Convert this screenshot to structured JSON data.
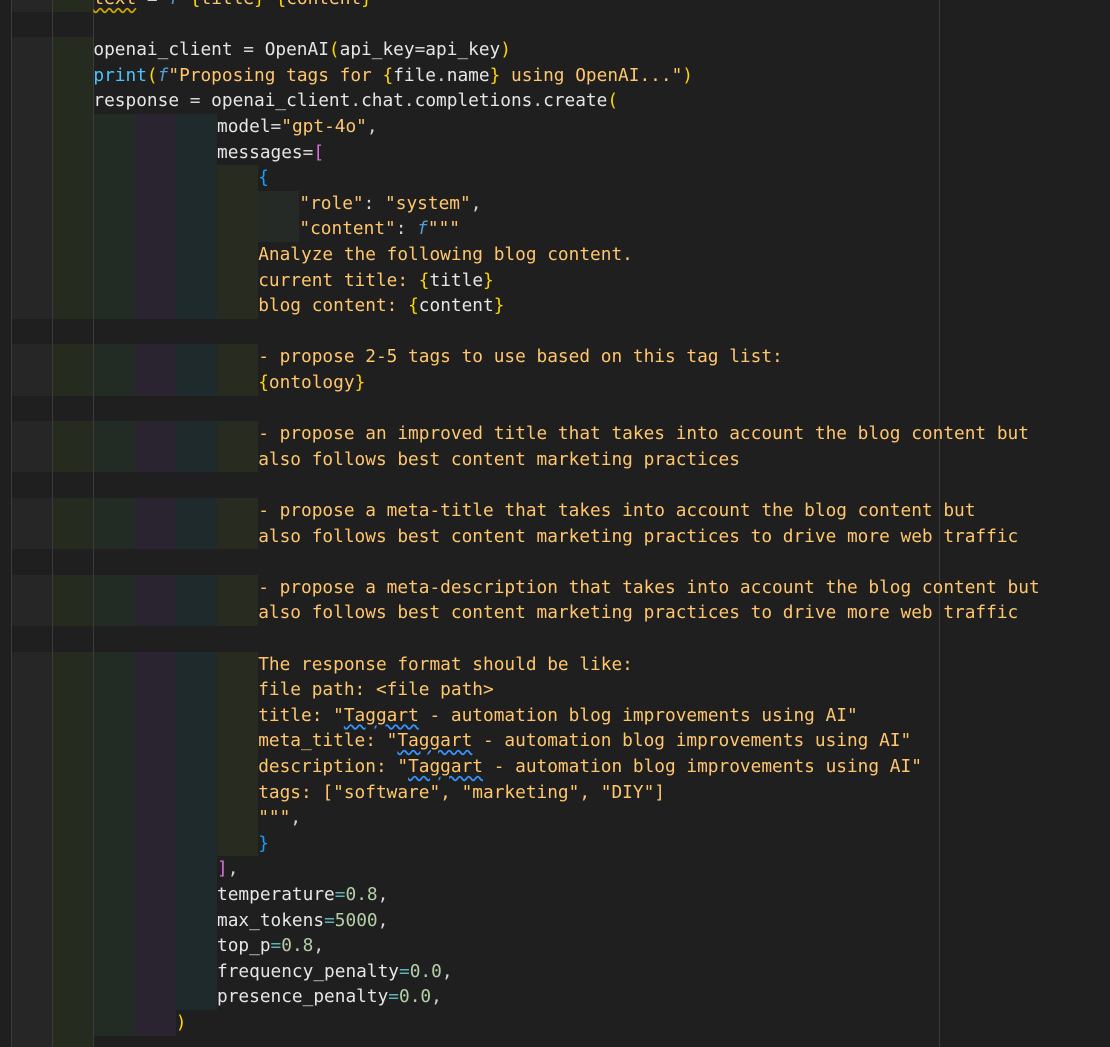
{
  "editor": {
    "colors": {
      "background": "#1f1f1f",
      "default": "#e6e6e6",
      "punct": "#d4d4d4",
      "string": "#ffc66d",
      "keyword_fn": "#4fc1ff",
      "fstring_prefix": "#569cd6",
      "brace_gold": "#ffd700",
      "bracket_pink": "#da70d6",
      "brace_blue": "#179fff",
      "number": "#b5cea8",
      "operator": "#5fb3b3",
      "variable": "#cfe2f3"
    },
    "lines": [
      {
        "indent": 9,
        "segments": [
          {
            "t": "text",
            "c": "#ffc66d",
            "sq": "gold"
          },
          {
            "t": " = ",
            "c": "#d4d4d4"
          },
          {
            "t": "f",
            "c": "#569cd6",
            "i": true
          },
          {
            "t": "\"",
            "c": "#ffc66d"
          },
          {
            "t": "{",
            "c": "#ffd700"
          },
          {
            "t": "title",
            "c": "#ffc66d"
          },
          {
            "t": "}",
            "c": "#ffd700"
          },
          {
            "t": " ",
            "c": "#ffc66d"
          },
          {
            "t": "{",
            "c": "#ffd700"
          },
          {
            "t": "content",
            "c": "#ffc66d"
          },
          {
            "t": "}",
            "c": "#ffd700"
          }
        ]
      },
      {
        "indent": 0,
        "segments": []
      },
      {
        "indent": 9,
        "segments": [
          {
            "t": "openai_client",
            "c": "#e6e6e6"
          },
          {
            "t": " = ",
            "c": "#d4d4d4"
          },
          {
            "t": "OpenAI",
            "c": "#e6e6e6"
          },
          {
            "t": "(",
            "c": "#ffd700"
          },
          {
            "t": "api_key",
            "c": "#e6e6e6"
          },
          {
            "t": "=",
            "c": "#d4d4d4"
          },
          {
            "t": "api_key",
            "c": "#e6e6e6"
          },
          {
            "t": ")",
            "c": "#ffd700"
          }
        ]
      },
      {
        "indent": 9,
        "segments": [
          {
            "t": "print",
            "c": "#4fc1ff"
          },
          {
            "t": "(",
            "c": "#ffd700"
          },
          {
            "t": "f",
            "c": "#569cd6",
            "i": true
          },
          {
            "t": "\"Proposing tags for ",
            "c": "#ffc66d"
          },
          {
            "t": "{",
            "c": "#ffd700"
          },
          {
            "t": "file",
            "c": "#e6e6e6"
          },
          {
            "t": ".",
            "c": "#d4d4d4"
          },
          {
            "t": "name",
            "c": "#e6e6e6"
          },
          {
            "t": "}",
            "c": "#ffd700"
          },
          {
            "t": " using OpenAI...\"",
            "c": "#ffc66d"
          },
          {
            "t": ")",
            "c": "#ffd700"
          }
        ]
      },
      {
        "indent": 9,
        "segments": [
          {
            "t": "response",
            "c": "#e6e6e6"
          },
          {
            "t": " = ",
            "c": "#d4d4d4"
          },
          {
            "t": "openai_client",
            "c": "#e6e6e6"
          },
          {
            "t": ".",
            "c": "#d4d4d4"
          },
          {
            "t": "chat",
            "c": "#e6e6e6"
          },
          {
            "t": ".",
            "c": "#d4d4d4"
          },
          {
            "t": "completions",
            "c": "#e6e6e6"
          },
          {
            "t": ".",
            "c": "#d4d4d4"
          },
          {
            "t": "create",
            "c": "#e6e6e6"
          },
          {
            "t": "(",
            "c": "#ffd700"
          }
        ]
      },
      {
        "indent": 21,
        "segments": [
          {
            "t": "model",
            "c": "#e6e6e6"
          },
          {
            "t": "=",
            "c": "#d4d4d4"
          },
          {
            "t": "\"gpt-4o\"",
            "c": "#ffc66d"
          },
          {
            "t": ",",
            "c": "#d4d4d4"
          }
        ]
      },
      {
        "indent": 21,
        "segments": [
          {
            "t": "messages",
            "c": "#e6e6e6"
          },
          {
            "t": "=",
            "c": "#d4d4d4"
          },
          {
            "t": "[",
            "c": "#da70d6"
          }
        ]
      },
      {
        "indent": 25,
        "segments": [
          {
            "t": "{",
            "c": "#179fff"
          }
        ]
      },
      {
        "indent": 29,
        "segments": [
          {
            "t": "\"role\"",
            "c": "#ffc66d"
          },
          {
            "t": ": ",
            "c": "#d4d4d4"
          },
          {
            "t": "\"system\"",
            "c": "#ffc66d"
          },
          {
            "t": ",",
            "c": "#d4d4d4"
          }
        ]
      },
      {
        "indent": 29,
        "segments": [
          {
            "t": "\"content\"",
            "c": "#ffc66d"
          },
          {
            "t": ": ",
            "c": "#d4d4d4"
          },
          {
            "t": "f",
            "c": "#569cd6",
            "i": true
          },
          {
            "t": "\"\"\"",
            "c": "#ffc66d"
          }
        ]
      },
      {
        "indent": 25,
        "segments": [
          {
            "t": "Analyze the following blog content.",
            "c": "#ffc66d"
          }
        ]
      },
      {
        "indent": 25,
        "segments": [
          {
            "t": "current title: ",
            "c": "#ffc66d"
          },
          {
            "t": "{",
            "c": "#ffd700"
          },
          {
            "t": "title",
            "c": "#e6e6e6"
          },
          {
            "t": "}",
            "c": "#ffd700"
          }
        ]
      },
      {
        "indent": 25,
        "segments": [
          {
            "t": "blog content: ",
            "c": "#ffc66d"
          },
          {
            "t": "{",
            "c": "#ffd700"
          },
          {
            "t": "content",
            "c": "#e6e6e6"
          },
          {
            "t": "}",
            "c": "#ffd700"
          }
        ]
      },
      {
        "indent": 0,
        "segments": []
      },
      {
        "indent": 25,
        "segments": [
          {
            "t": "- propose 2-5 tags to use based on this tag list:",
            "c": "#ffc66d"
          }
        ]
      },
      {
        "indent": 25,
        "segments": [
          {
            "t": "{",
            "c": "#ffd700"
          },
          {
            "t": "ontology",
            "c": "#ffc66d"
          },
          {
            "t": "}",
            "c": "#ffd700"
          }
        ]
      },
      {
        "indent": 0,
        "segments": []
      },
      {
        "indent": 25,
        "segments": [
          {
            "t": "- propose an improved title that takes into account the blog content but",
            "c": "#ffc66d"
          }
        ]
      },
      {
        "indent": 25,
        "segments": [
          {
            "t": "also follows best content marketing practices",
            "c": "#ffc66d"
          }
        ]
      },
      {
        "indent": 0,
        "segments": []
      },
      {
        "indent": 25,
        "segments": [
          {
            "t": "- propose a meta-title that takes into account the blog content but",
            "c": "#ffc66d"
          }
        ]
      },
      {
        "indent": 25,
        "segments": [
          {
            "t": "also follows best content marketing practices to drive more web traffic",
            "c": "#ffc66d"
          }
        ]
      },
      {
        "indent": 0,
        "segments": []
      },
      {
        "indent": 25,
        "segments": [
          {
            "t": "- propose a meta-description that takes into account the blog content but",
            "c": "#ffc66d"
          }
        ]
      },
      {
        "indent": 25,
        "segments": [
          {
            "t": "also follows best content marketing practices to drive more web traffic",
            "c": "#ffc66d"
          }
        ]
      },
      {
        "indent": 0,
        "segments": []
      },
      {
        "indent": 25,
        "segments": [
          {
            "t": "The response format should be like:",
            "c": "#ffc66d"
          }
        ]
      },
      {
        "indent": 25,
        "segments": [
          {
            "t": "file path: <file path>",
            "c": "#ffc66d"
          }
        ]
      },
      {
        "indent": 25,
        "segments": [
          {
            "t": "title: \"",
            "c": "#ffc66d"
          },
          {
            "t": "Taggart",
            "c": "#ffc66d",
            "sq": "blue"
          },
          {
            "t": " - automation blog improvements using AI\"",
            "c": "#ffc66d"
          }
        ]
      },
      {
        "indent": 25,
        "segments": [
          {
            "t": "meta_title: \"",
            "c": "#ffc66d"
          },
          {
            "t": "Taggart",
            "c": "#ffc66d",
            "sq": "blue"
          },
          {
            "t": " - automation blog improvements using AI\"",
            "c": "#ffc66d"
          }
        ]
      },
      {
        "indent": 25,
        "segments": [
          {
            "t": "description: \"",
            "c": "#ffc66d"
          },
          {
            "t": "Taggart",
            "c": "#ffc66d",
            "sq": "blue"
          },
          {
            "t": " - automation blog improvements using AI\"",
            "c": "#ffc66d"
          }
        ]
      },
      {
        "indent": 25,
        "segments": [
          {
            "t": "tags: [\"software\", \"marketing\", \"DIY\"]",
            "c": "#ffc66d"
          }
        ]
      },
      {
        "indent": 25,
        "segments": [
          {
            "t": "\"\"\"",
            "c": "#ffc66d"
          },
          {
            "t": ",",
            "c": "#d4d4d4"
          }
        ]
      },
      {
        "indent": 25,
        "segments": [
          {
            "t": "}",
            "c": "#179fff"
          }
        ]
      },
      {
        "indent": 21,
        "segments": [
          {
            "t": "]",
            "c": "#da70d6"
          },
          {
            "t": ",",
            "c": "#d4d4d4"
          }
        ]
      },
      {
        "indent": 21,
        "segments": [
          {
            "t": "temperature",
            "c": "#e6e6e6"
          },
          {
            "t": "=",
            "c": "#5fb3b3"
          },
          {
            "t": "0.8",
            "c": "#b5cea8"
          },
          {
            "t": ",",
            "c": "#d4d4d4"
          }
        ]
      },
      {
        "indent": 21,
        "segments": [
          {
            "t": "max_tokens",
            "c": "#e6e6e6"
          },
          {
            "t": "=",
            "c": "#5fb3b3"
          },
          {
            "t": "5000",
            "c": "#b5cea8"
          },
          {
            "t": ",",
            "c": "#d4d4d4"
          }
        ]
      },
      {
        "indent": 21,
        "segments": [
          {
            "t": "top_p",
            "c": "#e6e6e6"
          },
          {
            "t": "=",
            "c": "#5fb3b3"
          },
          {
            "t": "0.8",
            "c": "#b5cea8"
          },
          {
            "t": ",",
            "c": "#d4d4d4"
          }
        ]
      },
      {
        "indent": 21,
        "segments": [
          {
            "t": "frequency_penalty",
            "c": "#e6e6e6"
          },
          {
            "t": "=",
            "c": "#5fb3b3"
          },
          {
            "t": "0.0",
            "c": "#b5cea8"
          },
          {
            "t": ",",
            "c": "#d4d4d4"
          }
        ]
      },
      {
        "indent": 21,
        "segments": [
          {
            "t": "presence_penalty",
            "c": "#e6e6e6"
          },
          {
            "t": "=",
            "c": "#5fb3b3"
          },
          {
            "t": "0.0",
            "c": "#b5cea8"
          },
          {
            "t": ",",
            "c": "#d4d4d4"
          }
        ]
      },
      {
        "indent": 17,
        "segments": [
          {
            "t": ")",
            "c": "#ffd700"
          }
        ]
      },
      {
        "indent": 9,
        "segments": []
      }
    ]
  }
}
